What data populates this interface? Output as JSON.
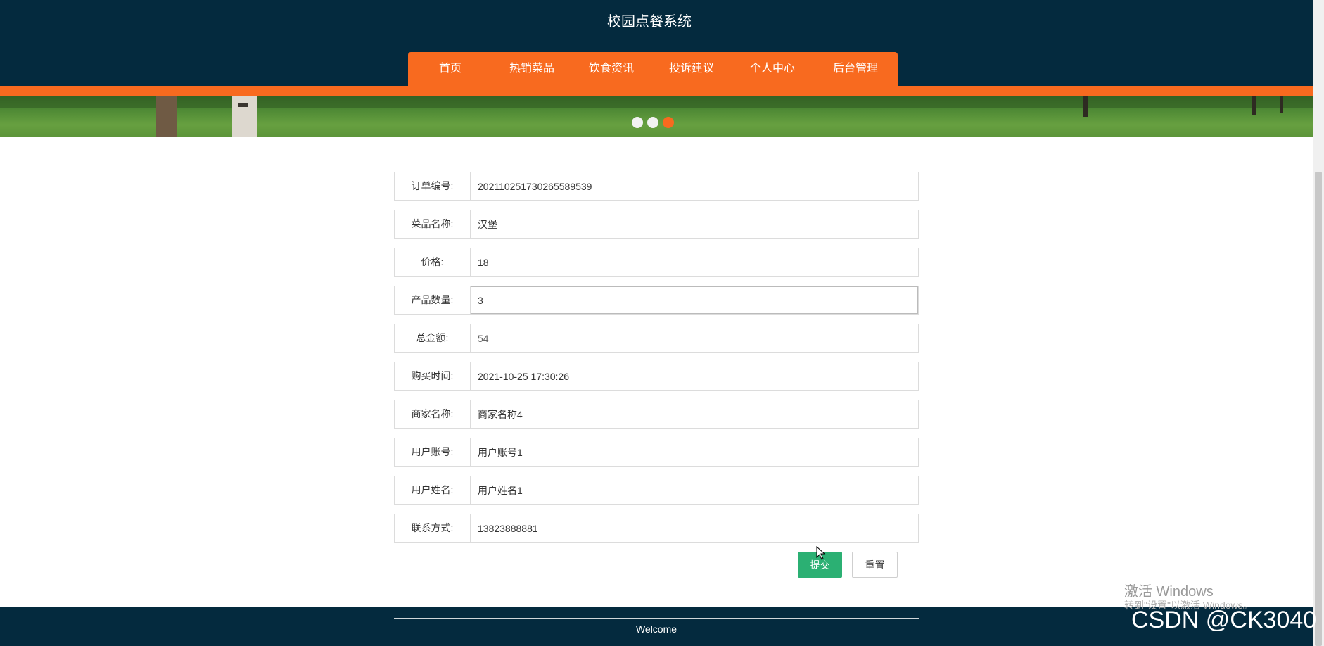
{
  "header": {
    "title": "校园点餐系统"
  },
  "nav": {
    "items": [
      "首页",
      "热销菜品",
      "饮食资讯",
      "投诉建议",
      "个人中心",
      "后台管理"
    ]
  },
  "carousel": {
    "active_index": 2,
    "count": 3
  },
  "form": {
    "fields": [
      {
        "label": "订单编号:",
        "value": "202110251730265589539"
      },
      {
        "label": "菜品名称:",
        "value": "汉堡"
      },
      {
        "label": "价格:",
        "value": "18"
      },
      {
        "label": "产品数量:",
        "value": "3"
      },
      {
        "label": "总金额:",
        "value": "54"
      },
      {
        "label": "购买时间:",
        "value": "2021-10-25 17:30:26"
      },
      {
        "label": "商家名称:",
        "value": "商家名称4"
      },
      {
        "label": "用户账号:",
        "value": "用户账号1"
      },
      {
        "label": "用户姓名:",
        "value": "用户姓名1"
      },
      {
        "label": "联系方式:",
        "value": "13823888881"
      }
    ],
    "submit_label": "提交",
    "reset_label": "重置"
  },
  "footer": {
    "text": "Welcome"
  },
  "overlay": {
    "activation_title": "激活 Windows",
    "activation_hint": "转到\"设置\"以激活 Windows。",
    "csdn_watermark": "CSDN @CK3040"
  },
  "colors": {
    "header": "#042a3e",
    "accent": "#f86a1f",
    "submit": "#2bb073"
  }
}
